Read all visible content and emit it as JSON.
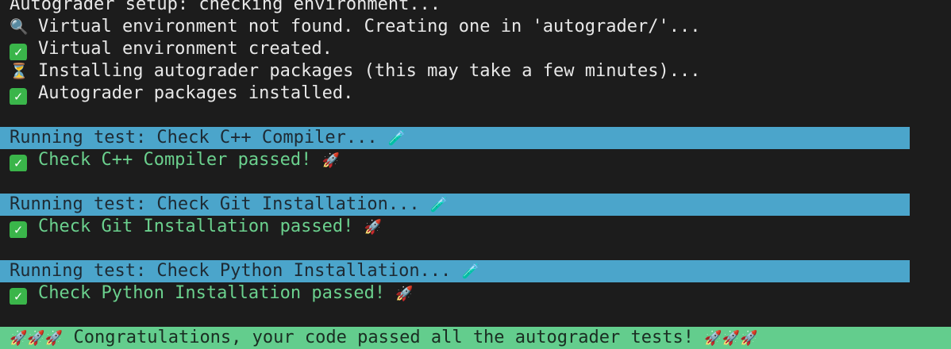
{
  "terminal": {
    "clipped_top": "Autograder setup: checking environment...",
    "venv_not_found": "Virtual environment not found. Creating one in 'autograder/'...",
    "venv_created": "Virtual environment created.",
    "installing": "Installing autograder packages (this may take a few minutes)...",
    "installed": "Autograder packages installed.",
    "tests": [
      {
        "running": "Running test: Check C++ Compiler...",
        "passed": "Check C++ Compiler passed!"
      },
      {
        "running": "Running test: Check Git Installation...",
        "passed": "Check Git Installation passed!"
      },
      {
        "running": "Running test: Check Python Installation...",
        "passed": "Check Python Installation passed!"
      }
    ],
    "congrats": "Congratulations, your code passed all the autograder tests!"
  },
  "icons": {
    "magnifier": "magnifier-icon",
    "check": "check-icon",
    "hourglass": "hourglass-icon",
    "test_tube": "test-tube-icon",
    "rocket": "rocket-icon"
  },
  "colors": {
    "background": "#1c1c1c",
    "running_highlight": "#4ba5cb",
    "passed_text": "#6bd18e",
    "congrats_highlight": "#63cd8d"
  }
}
